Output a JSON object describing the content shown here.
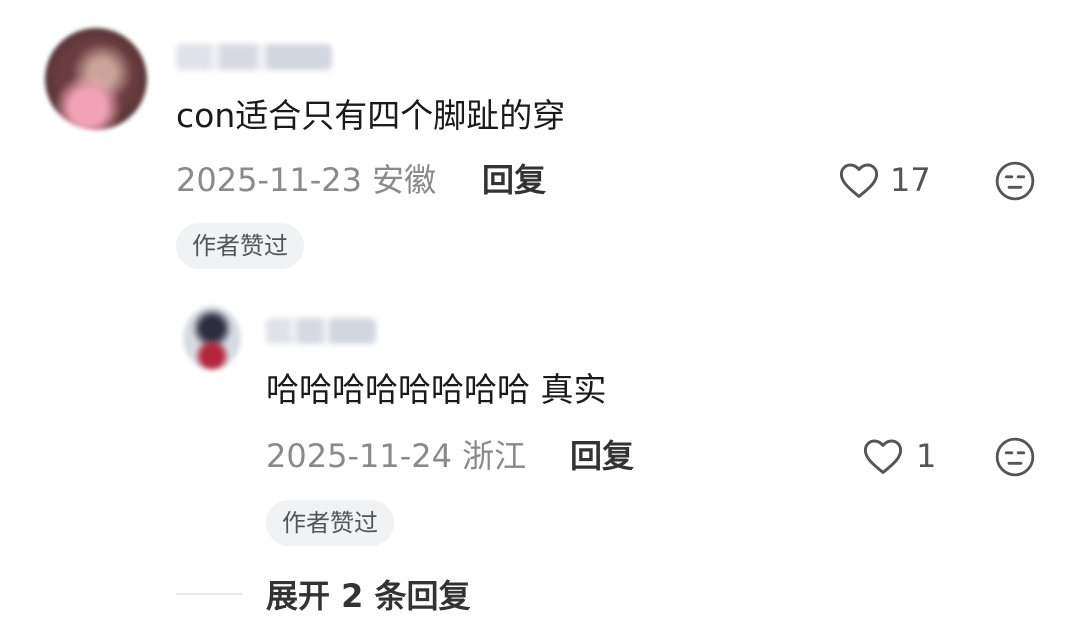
{
  "comment": {
    "text": "con适合只有四个脚趾的穿",
    "date": "2025-11-23",
    "location": "安徽",
    "reply_label": "回复",
    "likes": "17",
    "badge": "作者赞过"
  },
  "reply": {
    "text": "哈哈哈哈哈哈哈哈 真实",
    "date": "2025-11-24",
    "location": "浙江",
    "reply_label": "回复",
    "likes": "1",
    "badge": "作者赞过"
  },
  "expand": {
    "label": "展开 2 条回复"
  },
  "icons": {
    "like": "heart-icon",
    "dislike": "unamused-face-icon"
  }
}
